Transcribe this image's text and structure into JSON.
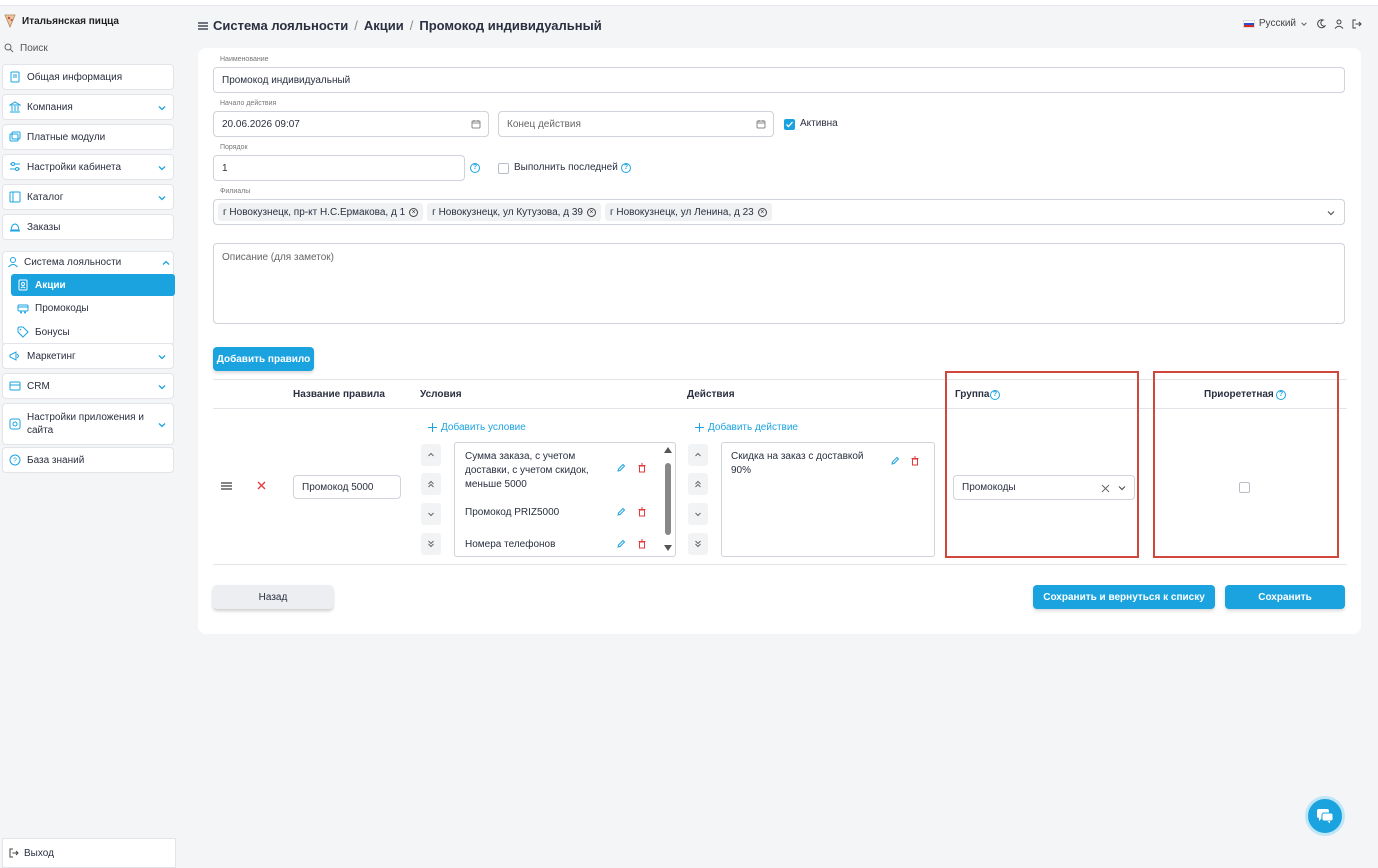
{
  "sidebar": {
    "brand": "Итальянская пицца",
    "search_label": "Поиск",
    "items": [
      {
        "label": "Общая информация"
      },
      {
        "label": "Компания"
      },
      {
        "label": "Платные модули"
      },
      {
        "label": "Настройки кабинета"
      },
      {
        "label": "Каталог"
      },
      {
        "label": "Заказы"
      },
      {
        "label": "Система лояльности"
      },
      {
        "label": "Маркетинг"
      },
      {
        "label": "CRM"
      },
      {
        "label": "Настройки приложения и сайта"
      },
      {
        "label": "База знаний"
      }
    ],
    "loyalty_sub": [
      {
        "label": "Акции"
      },
      {
        "label": "Промокоды"
      },
      {
        "label": "Бонусы"
      }
    ],
    "logout": "Выход"
  },
  "header": {
    "breadcrumb": [
      "Система лояльности",
      "Акции",
      "Промокод индивидуальный"
    ],
    "separator": "/",
    "language": "Русский"
  },
  "form": {
    "name_label": "Наименование",
    "name_value": "Промокод индивидуальный",
    "start_label": "Начало действия",
    "start_value": "20.06.2026 09:07",
    "end_placeholder": "Конец действия",
    "active_label": "Активна",
    "order_label": "Порядок",
    "order_value": "1",
    "last_label": "Выполнить последней",
    "branches_label": "Филиалы",
    "branches": [
      "г Новокузнецк, пр-кт Н.С.Ермакова, д 1",
      "г Новокузнецк, ул Кутузова, д 39",
      "г Новокузнецк, ул Ленина, д 23"
    ],
    "description_placeholder": "Описание (для заметок)",
    "add_rule": "Добавить правило"
  },
  "rules": {
    "headers": {
      "name": "Название правила",
      "conditions": "Условия",
      "actions": "Действия",
      "group": "Группа",
      "priority": "Приорететная"
    },
    "add_condition": "Добавить условие",
    "add_action": "Добавить действие",
    "row": {
      "name": "Промокод 5000",
      "conditions": [
        "Сумма заказа, с учетом доставки, с учетом скидок, меньше 5000",
        "Промокод PRIZ5000",
        "Номера телефонов"
      ],
      "actions": [
        "Скидка на заказ с доставкой 90%"
      ],
      "group": "Промокоды"
    }
  },
  "footer": {
    "back": "Назад",
    "save_return": "Сохранить и вернуться к списку",
    "save": "Сохранить"
  },
  "colors": {
    "accent": "#1ba3e0",
    "highlight": "#d1473b"
  }
}
